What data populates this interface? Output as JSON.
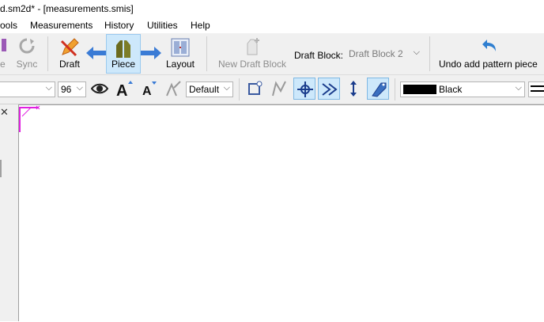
{
  "window": {
    "title": "d.sm2d* - [measurements.smis]"
  },
  "menu": [
    "ools",
    "Measurements",
    "History",
    "Utilities",
    "Help"
  ],
  "toolbar": {
    "partial_left_label": "e",
    "sync_label": "Sync",
    "draft_label": "Draft",
    "piece_label": "Piece",
    "layout_label": "Layout",
    "new_draft_block_label": "New Draft Block",
    "draft_block_caption": "Draft Block:",
    "draft_block_value": "Draft Block 2",
    "undo_label": "Undo add pattern piece"
  },
  "toolbar2": {
    "zoom_value": "96",
    "text_style_value": "Default",
    "color_value": "Black"
  },
  "colors": {
    "accent": "#cde8fb",
    "line_color": "#000000",
    "magenta": "#e020e0"
  }
}
